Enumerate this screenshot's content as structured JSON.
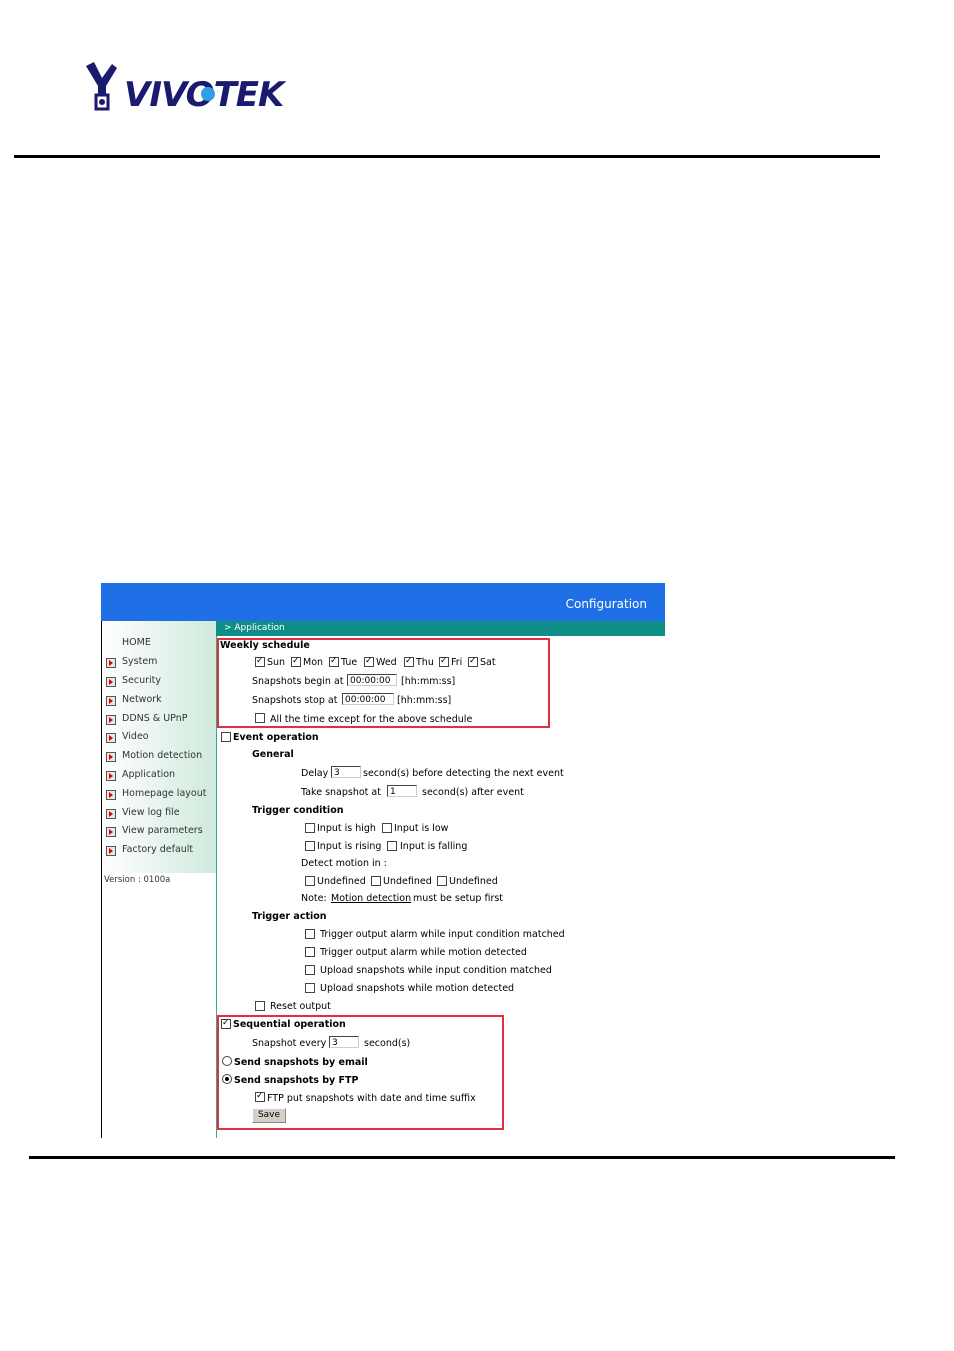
{
  "logo": {
    "text": "VIVOTEK"
  },
  "banner": {
    "title": "Configuration"
  },
  "breadcrumb": "> Application",
  "sidebar": {
    "home": "HOME",
    "items": [
      "System",
      "Security",
      "Network",
      "DDNS & UPnP",
      "Video",
      "Motion detection",
      "Application",
      "Homepage layout",
      "View log file",
      "View parameters",
      "Factory default"
    ],
    "version": "Version : 0100a"
  },
  "weekly": {
    "title": "Weekly schedule",
    "days": [
      {
        "label": "Sun",
        "checked": true
      },
      {
        "label": "Mon",
        "checked": true
      },
      {
        "label": "Tue",
        "checked": true
      },
      {
        "label": "Wed",
        "checked": true
      },
      {
        "label": "Thu",
        "checked": true
      },
      {
        "label": "Fri",
        "checked": true
      },
      {
        "label": "Sat",
        "checked": true
      }
    ],
    "begin_label": "Snapshots begin at",
    "begin_value": "00:00:00",
    "begin_hint": "[hh:mm:ss]",
    "stop_label": "Snapshots stop at",
    "stop_value": "00:00:00",
    "stop_hint": "[hh:mm:ss]",
    "except_label": "All the time except for the above schedule",
    "except_checked": false
  },
  "event": {
    "title": "Event operation",
    "checked": false,
    "general": "General",
    "delay_label": "Delay",
    "delay_value": "3",
    "delay_suffix": "second(s) before detecting the next event",
    "take_label": "Take snapshot at",
    "take_value": "1",
    "take_suffix": "second(s) after event",
    "trigger_condition": "Trigger condition",
    "input_high": "Input is high",
    "input_low": "Input is low",
    "input_rising": "Input is rising",
    "input_falling": "Input is falling",
    "detect_motion": "Detect motion in :",
    "undefined1": "Undefined",
    "undefined2": "Undefined",
    "undefined3": "Undefined",
    "note_prefix": "Note:",
    "note_link": "Motion detection",
    "note_suffix": "must be setup first",
    "trigger_action": "Trigger action",
    "action1": "Trigger output alarm while input condition matched",
    "action2": "Trigger output alarm while motion detected",
    "action3": "Upload snapshots while input condition matched",
    "action4": "Upload snapshots while motion detected",
    "reset_output": "Reset output"
  },
  "sequential": {
    "title": "Sequential operation",
    "checked": true,
    "every_label": "Snapshot every",
    "every_value": "3",
    "every_suffix": "second(s)"
  },
  "send_email": {
    "label": "Send snapshots by email",
    "selected": false
  },
  "send_ftp": {
    "label": "Send snapshots by FTP",
    "selected": true
  },
  "ftp_suffix": {
    "label": "FTP put snapshots with date and time suffix",
    "checked": true
  },
  "save_label": "Save"
}
